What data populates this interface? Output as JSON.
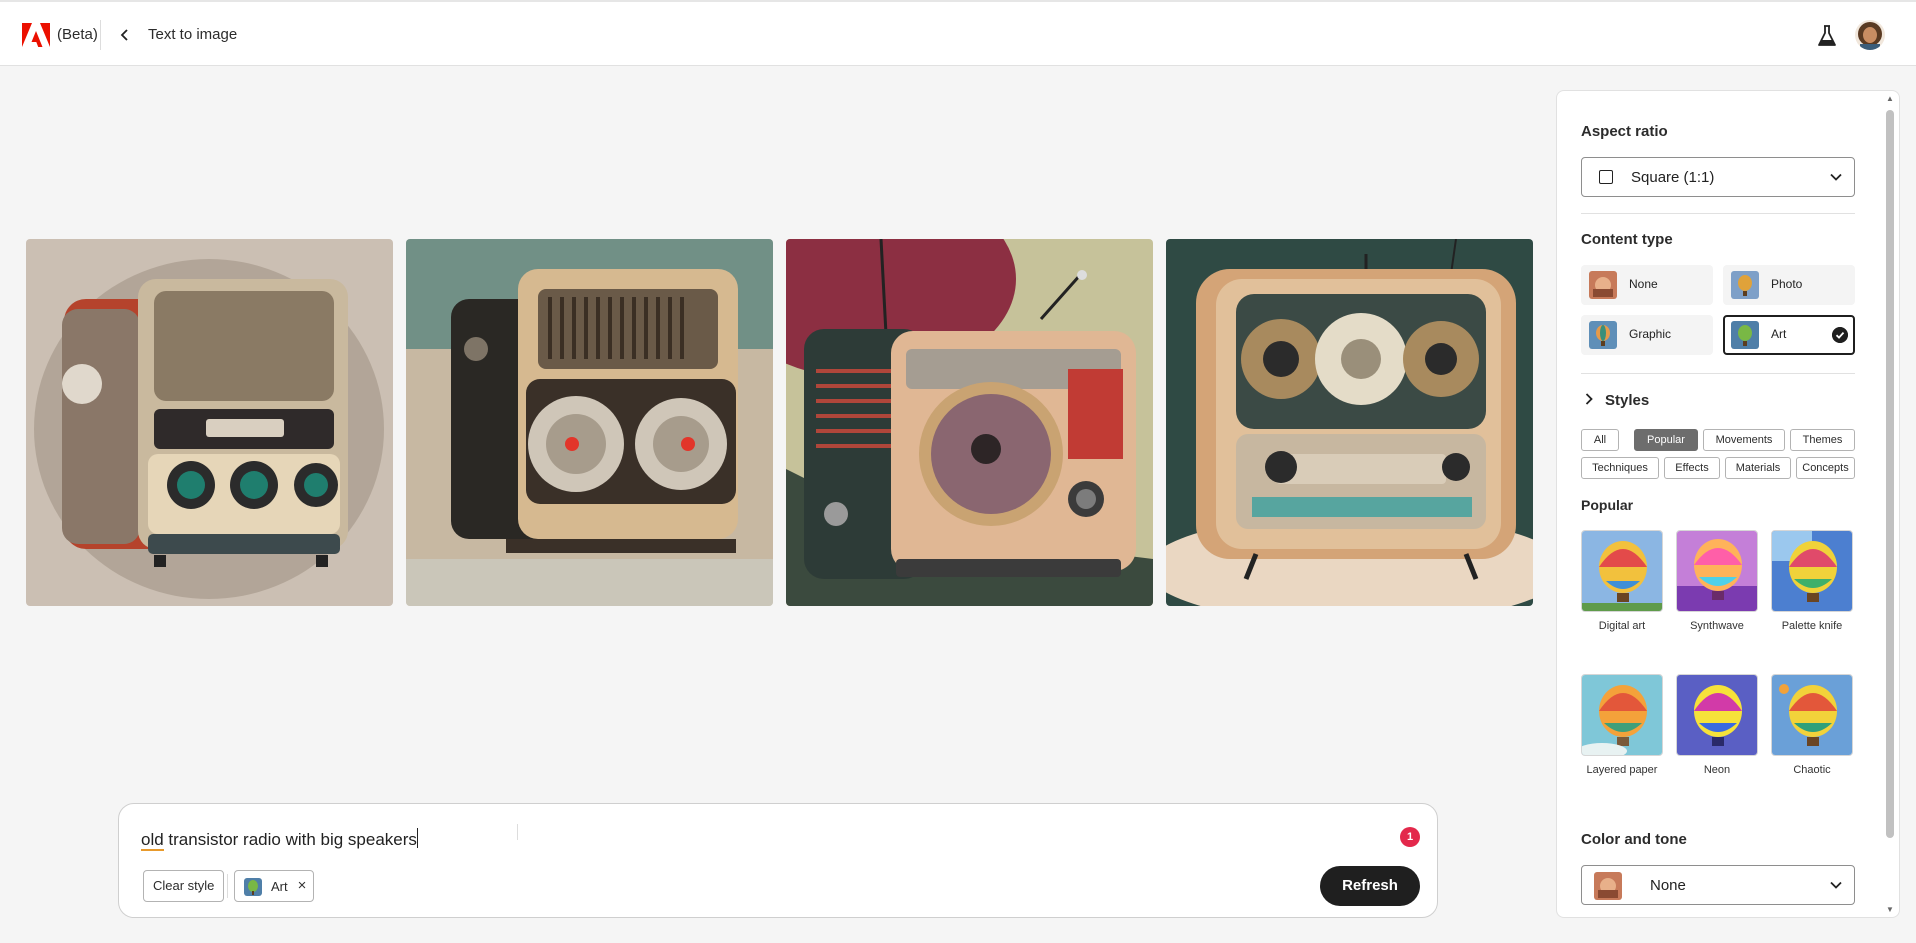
{
  "header": {
    "beta_label": "(Beta)",
    "page_title": "Text to image"
  },
  "gallery": {
    "images": [
      {
        "name": "generated-image-1"
      },
      {
        "name": "generated-image-2"
      },
      {
        "name": "generated-image-3"
      },
      {
        "name": "generated-image-4"
      }
    ]
  },
  "prompt": {
    "text_start": "old",
    "text_rest": " transistor radio with big speakers",
    "notification_count": "1",
    "clear_style_label": "Clear style",
    "chip_label": "Art",
    "chip_close": "×",
    "refresh_label": "Refresh"
  },
  "panel": {
    "aspect_ratio": {
      "title": "Aspect ratio",
      "value": "Square (1:1)"
    },
    "content_type": {
      "title": "Content type",
      "options": [
        "None",
        "Photo",
        "Graphic",
        "Art"
      ],
      "selected": "Art"
    },
    "styles": {
      "title": "Styles",
      "tabs": [
        "All",
        "Popular",
        "Movements",
        "Themes",
        "Techniques",
        "Effects",
        "Materials",
        "Concepts"
      ],
      "active_tab": "Popular",
      "section_title": "Popular",
      "items": [
        "Digital art",
        "Synthwave",
        "Palette knife",
        "Layered paper",
        "Neon",
        "Chaotic"
      ]
    },
    "color_tone": {
      "title": "Color and tone",
      "value": "None"
    }
  },
  "colors": {
    "accent_dark": "#1f1f1f",
    "adobe_red": "#eb1000",
    "badge_red": "#e3284b",
    "active_pill": "#6d6d6d"
  }
}
